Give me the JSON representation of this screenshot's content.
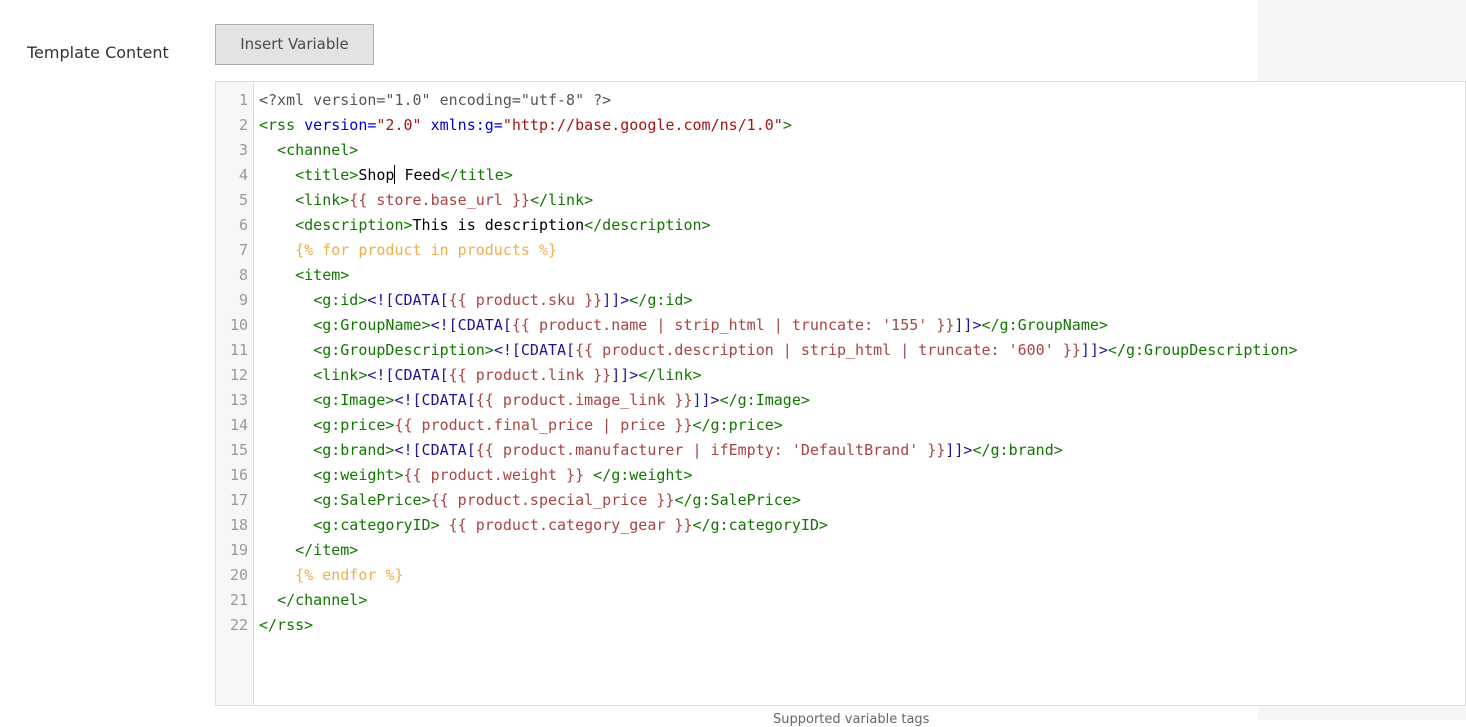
{
  "form": {
    "label": "Template Content",
    "insert_button": "Insert Variable"
  },
  "editor": {
    "lines": [
      [
        [
          "meta",
          "<?xml version=\"1.0\" encoding=\"utf-8\" ?>"
        ]
      ],
      [
        [
          "tag",
          "<rss "
        ],
        [
          "attr",
          "version="
        ],
        [
          "str",
          "\"2.0\""
        ],
        [
          "text",
          " "
        ],
        [
          "attr",
          "xmlns:g="
        ],
        [
          "str",
          "\"http://base.google.com/ns/1.0\""
        ],
        [
          "tag",
          ">"
        ]
      ],
      [
        [
          "text",
          "  "
        ],
        [
          "tag",
          "<channel>"
        ]
      ],
      [
        [
          "text",
          "    "
        ],
        [
          "tag",
          "<title>"
        ],
        [
          "text",
          "Shop"
        ],
        [
          "cursor",
          ""
        ],
        [
          "text",
          " Feed"
        ],
        [
          "tag",
          "</title>"
        ]
      ],
      [
        [
          "text",
          "    "
        ],
        [
          "tag",
          "<link>"
        ],
        [
          "var",
          "{{ store.base_url }}"
        ],
        [
          "tag",
          "</link>"
        ]
      ],
      [
        [
          "text",
          "    "
        ],
        [
          "tag",
          "<description>"
        ],
        [
          "text",
          "This is description"
        ],
        [
          "tag",
          "</description>"
        ]
      ],
      [
        [
          "text",
          "    "
        ],
        [
          "stmt",
          "{% for product in products %}"
        ]
      ],
      [
        [
          "text",
          "    "
        ],
        [
          "tag",
          "<item>"
        ]
      ],
      [
        [
          "text",
          "      "
        ],
        [
          "tag",
          "<g:id>"
        ],
        [
          "cdata",
          "<![CDATA["
        ],
        [
          "var",
          "{{ product.sku }}"
        ],
        [
          "cdata",
          "]]>"
        ],
        [
          "tag",
          "</g:id>"
        ]
      ],
      [
        [
          "text",
          "      "
        ],
        [
          "tag",
          "<g:GroupName>"
        ],
        [
          "cdata",
          "<![CDATA["
        ],
        [
          "var",
          "{{ product.name | strip_html | truncate: '155' }}"
        ],
        [
          "cdata",
          "]]>"
        ],
        [
          "tag",
          "</g:GroupName>"
        ]
      ],
      [
        [
          "text",
          "      "
        ],
        [
          "tag",
          "<g:GroupDescription>"
        ],
        [
          "cdata",
          "<![CDATA["
        ],
        [
          "var",
          "{{ product.description | strip_html | truncate: '600' }}"
        ],
        [
          "cdata",
          "]]>"
        ],
        [
          "tag",
          "</g:GroupDescription>"
        ]
      ],
      [
        [
          "text",
          "      "
        ],
        [
          "tag",
          "<link>"
        ],
        [
          "cdata",
          "<![CDATA["
        ],
        [
          "var",
          "{{ product.link }}"
        ],
        [
          "cdata",
          "]]>"
        ],
        [
          "tag",
          "</link>"
        ]
      ],
      [
        [
          "text",
          "      "
        ],
        [
          "tag",
          "<g:Image>"
        ],
        [
          "cdata",
          "<![CDATA["
        ],
        [
          "var",
          "{{ product.image_link }}"
        ],
        [
          "cdata",
          "]]>"
        ],
        [
          "tag",
          "</g:Image>"
        ]
      ],
      [
        [
          "text",
          "      "
        ],
        [
          "tag",
          "<g:price>"
        ],
        [
          "var",
          "{{ product.final_price | price }}"
        ],
        [
          "tag",
          "</g:price>"
        ]
      ],
      [
        [
          "text",
          "      "
        ],
        [
          "tag",
          "<g:brand>"
        ],
        [
          "cdata",
          "<![CDATA["
        ],
        [
          "var",
          "{{ product.manufacturer | ifEmpty: 'DefaultBrand' }}"
        ],
        [
          "cdata",
          "]]>"
        ],
        [
          "tag",
          "</g:brand>"
        ]
      ],
      [
        [
          "text",
          "      "
        ],
        [
          "tag",
          "<g:weight>"
        ],
        [
          "var",
          "{{ product.weight }} "
        ],
        [
          "tag",
          "</g:weight>"
        ]
      ],
      [
        [
          "text",
          "      "
        ],
        [
          "tag",
          "<g:SalePrice>"
        ],
        [
          "var",
          "{{ product.special_price }}"
        ],
        [
          "tag",
          "</g:SalePrice>"
        ]
      ],
      [
        [
          "text",
          "      "
        ],
        [
          "tag",
          "<g:categoryID>"
        ],
        [
          "var",
          " {{ product.category_gear }}"
        ],
        [
          "tag",
          "</g:categoryID>"
        ]
      ],
      [
        [
          "text",
          "    "
        ],
        [
          "tag",
          "</item>"
        ]
      ],
      [
        [
          "text",
          "    "
        ],
        [
          "stmt",
          "{% endfor %}"
        ]
      ],
      [
        [
          "text",
          "  "
        ],
        [
          "tag",
          "</channel>"
        ]
      ],
      [
        [
          "tag",
          "</rss>"
        ]
      ]
    ]
  },
  "footer": {
    "hint": "Supported variable tags"
  },
  "colors": {
    "tag": "#117700",
    "attr": "#0000cc",
    "string": "#aa1111",
    "variable": "#a94442",
    "statement": "#f0ad4e",
    "cdata": "#221199",
    "gutter_bg": "#f7f7f7",
    "side_panel_bg": "#f5f5f5"
  }
}
